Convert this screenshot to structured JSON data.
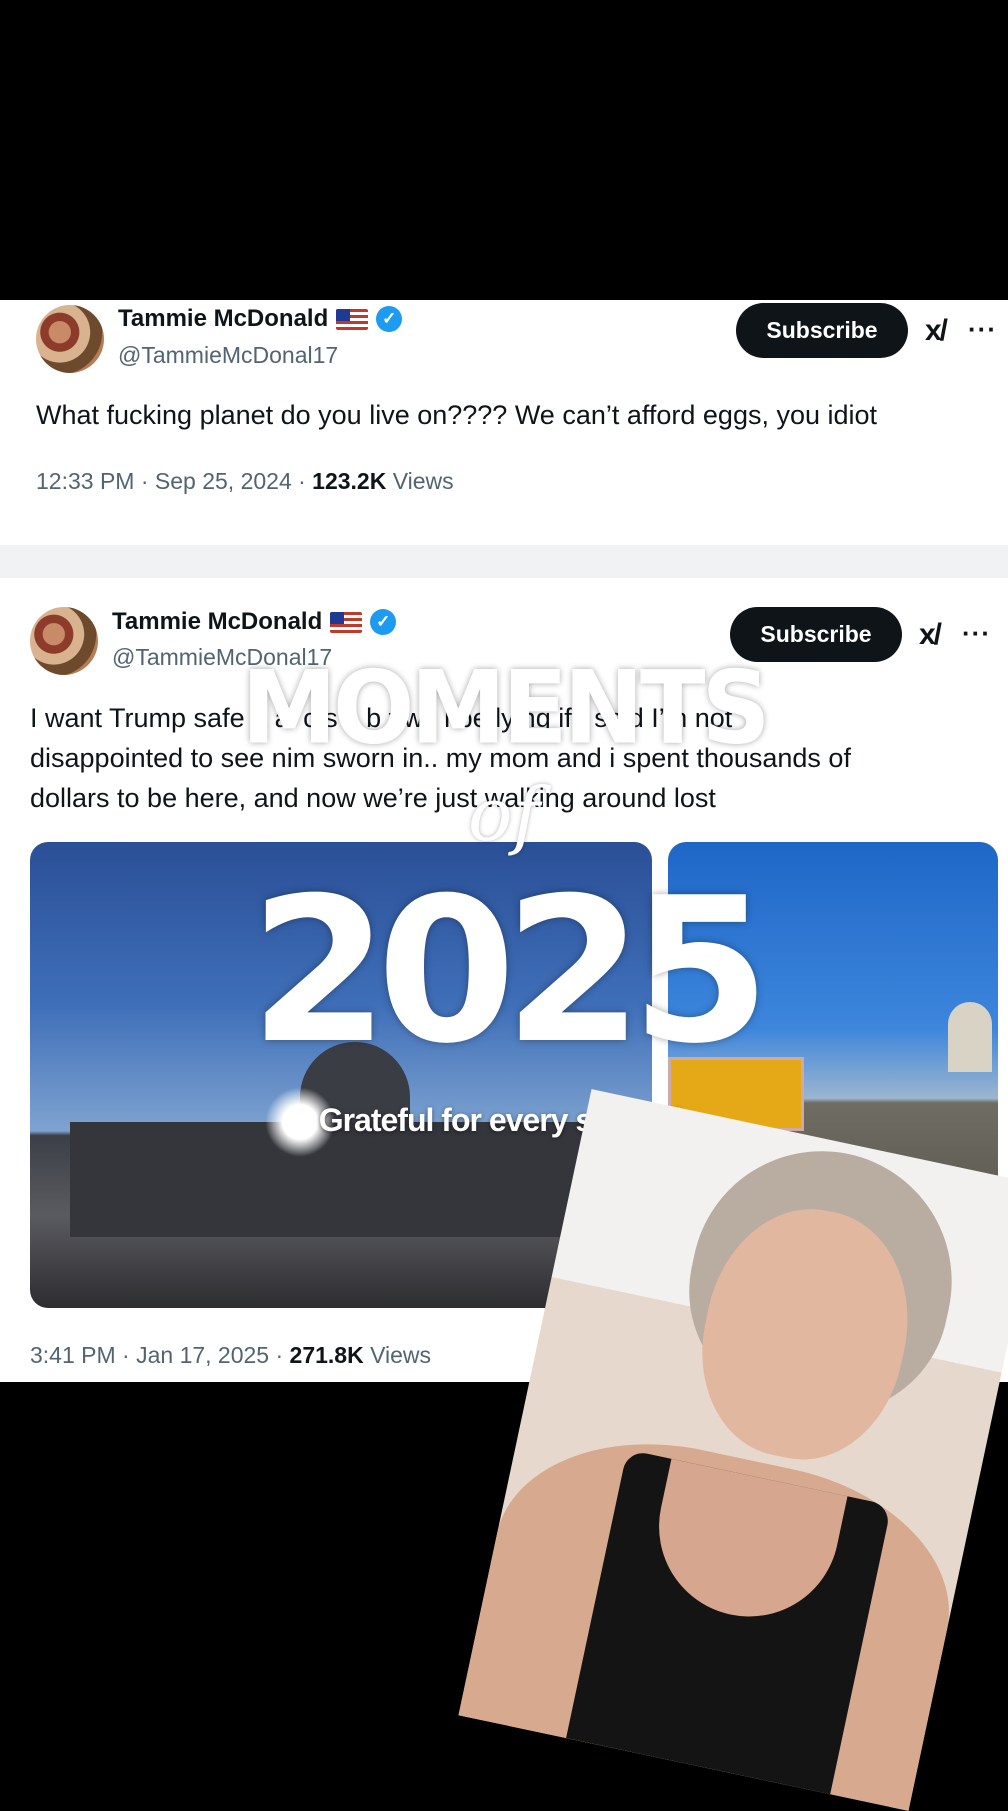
{
  "tweet1": {
    "name": "Tammie McDonald",
    "handle": "@TammieMcDonal17",
    "subscribe_label": "Subscribe",
    "xai_label": "x/",
    "more_label": "···",
    "text": "What fucking planet do you live on???? We can’t afford eggs, you idiot",
    "time_date": "12:33 PM · Sep 25, 2024 · ",
    "views_count": "123.2K",
    "views_label": " Views"
  },
  "tweet2": {
    "name": "Tammie McDonald",
    "handle": "@TammieMcDonal17",
    "subscribe_label": "Subscribe",
    "xai_label": "x/",
    "more_label": "···",
    "text_line1": "I want Trump safe a  al  c  s  s  b  t  wc  l  be lying if I said I’m not",
    "text_line2": "disappointed to see nim sworn in.. my mom and i spent thousands of",
    "text_line3": "dollars to be here, and now we’re just walking around lost",
    "time_date": "3:41 PM · Jan 17, 2025 · ",
    "views_count": "271.8K",
    "views_label": " Views"
  },
  "overlay": {
    "moments": "MOMENTS",
    "of": "of",
    "year": "2025",
    "caption": "Grateful for every second."
  },
  "colors": {
    "accent": "#1d9bf0",
    "button_bg": "#0f1419",
    "secondary_text": "#536471"
  }
}
